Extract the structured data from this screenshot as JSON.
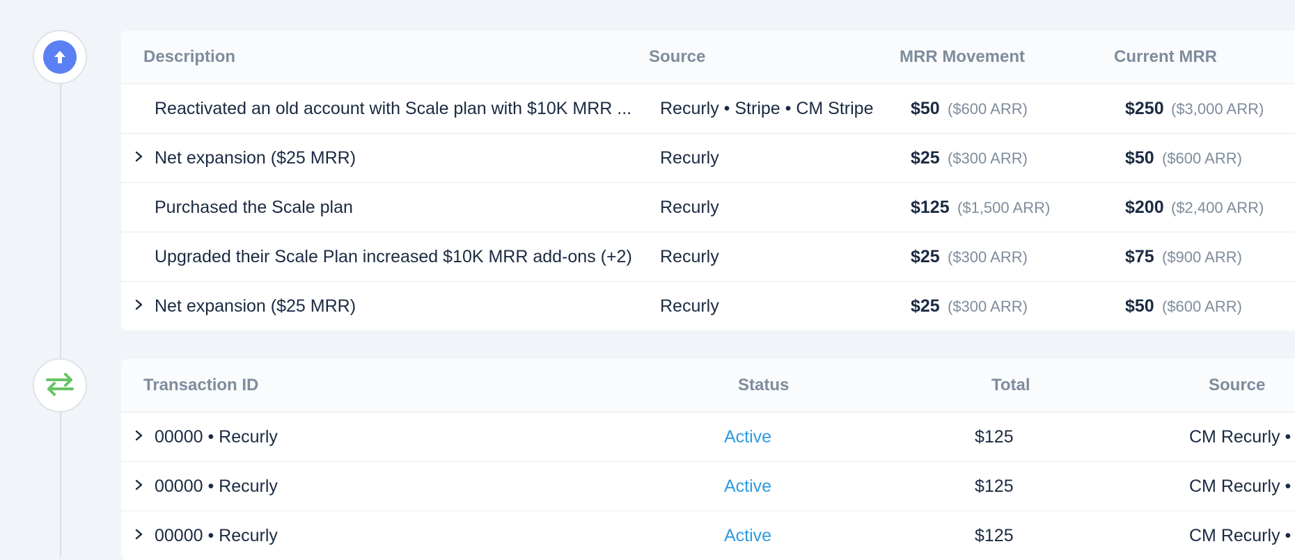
{
  "mrr_table": {
    "headers": {
      "description": "Description",
      "source": "Source",
      "mrr_movement": "MRR Movement",
      "current_mrr": "Current MRR"
    },
    "rows": [
      {
        "expandable": false,
        "description": "Reactivated an old account with Scale plan with $10K MRR ...",
        "source": "Recurly • Stripe • CM Stripe",
        "movement": "$50",
        "movement_arr": "($600 ARR)",
        "current": "$250",
        "current_arr": "($3,000 ARR)"
      },
      {
        "expandable": true,
        "description": "Net expansion ($25 MRR)",
        "source": "Recurly",
        "movement": "$25",
        "movement_arr": "($300 ARR)",
        "current": "$50",
        "current_arr": "($600 ARR)"
      },
      {
        "expandable": false,
        "description": "Purchased the Scale plan",
        "source": "Recurly",
        "movement": "$125",
        "movement_arr": "($1,500 ARR)",
        "current": "$200",
        "current_arr": "($2,400 ARR)"
      },
      {
        "expandable": false,
        "description": "Upgraded their Scale Plan increased $10K MRR add-ons (+2)",
        "source": "Recurly",
        "movement": "$25",
        "movement_arr": "($300 ARR)",
        "current": "$75",
        "current_arr": "($900 ARR)"
      },
      {
        "expandable": true,
        "description": "Net expansion ($25 MRR)",
        "source": "Recurly",
        "movement": "$25",
        "movement_arr": "($300 ARR)",
        "current": "$50",
        "current_arr": "($600 ARR)"
      }
    ]
  },
  "transactions_table": {
    "headers": {
      "transaction_id": "Transaction ID",
      "status": "Status",
      "total": "Total",
      "source": "Source"
    },
    "rows": [
      {
        "id": "00000 • Recurly",
        "status": "Active",
        "total": "$125",
        "source": "CM Recurly • R"
      },
      {
        "id": "00000 • Recurly",
        "status": "Active",
        "total": "$125",
        "source": "CM Recurly • R"
      },
      {
        "id": "00000 • Recurly",
        "status": "Active",
        "total": "$125",
        "source": "CM Recurly • R"
      }
    ]
  },
  "icons": {
    "upgrade": "arrow-up-icon",
    "transactions": "transfer-arrows-icon",
    "expand": "chevron-right-icon"
  },
  "colors": {
    "accent_blue": "#5b80f4",
    "transfer_green": "#66c466",
    "status_active": "#2f9be0"
  }
}
